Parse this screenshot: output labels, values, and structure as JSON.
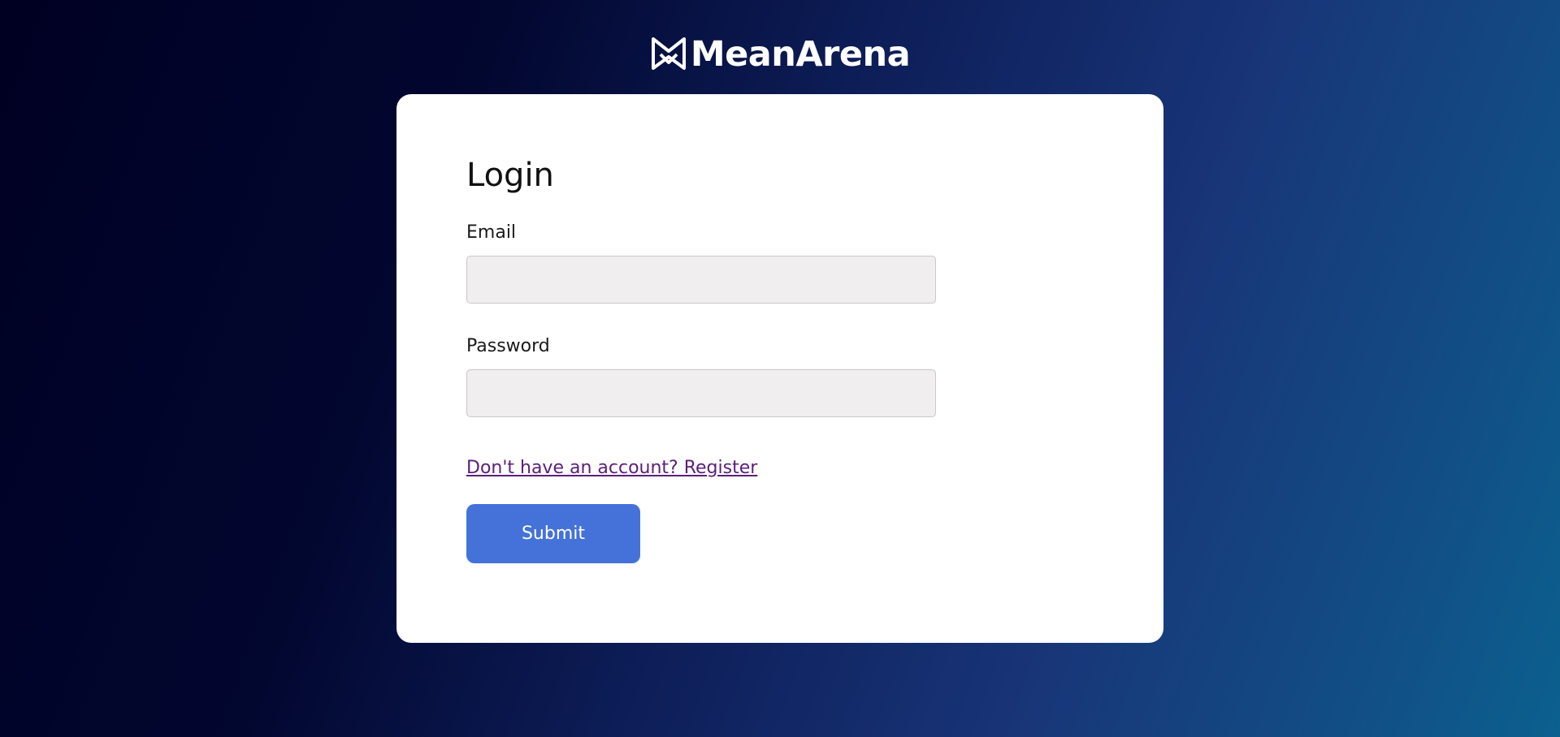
{
  "brand": {
    "name": "MeanArena",
    "logo_icon": "mean-arena-logo-icon"
  },
  "login": {
    "title": "Login",
    "email_label": "Email",
    "email_value": "",
    "email_placeholder": "",
    "password_label": "Password",
    "password_value": "",
    "password_placeholder": "",
    "register_link": "Don't have an account? Register",
    "submit_label": "Submit"
  },
  "colors": {
    "background_dark": "#000022",
    "background_light": "#0b608e",
    "card": "#ffffff",
    "input_background": "#f0eeef",
    "link": "#5a1f7a",
    "submit_button": "#4472d9"
  }
}
